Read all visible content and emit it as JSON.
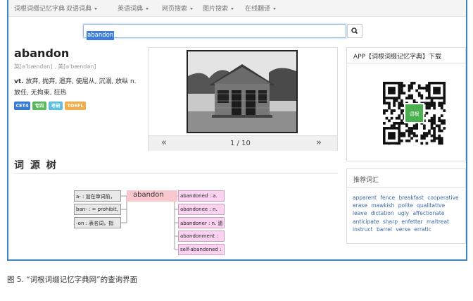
{
  "navbar": {
    "brand": "词根词缀记忆字典",
    "items": [
      {
        "label": "双语词典"
      },
      {
        "label": "英语词典"
      },
      {
        "label": "网页搜索"
      },
      {
        "label": "图片搜索"
      },
      {
        "label": "在线翻译"
      }
    ]
  },
  "search": {
    "value": "abandon"
  },
  "entry": {
    "word": "abandon",
    "phonetic": "英[ə'bændən] , 美[ə'bændən]",
    "pos": "vt.",
    "definition_line1": "放弃, 抛弃, 遗弃, 使屈从, 沉溺, 放纵 n.",
    "definition_line2": "放任, 无拘束, 狂热",
    "tags": [
      {
        "label": "CET4",
        "color": "#3a7bd5"
      },
      {
        "label": "专四",
        "color": "#5cb85c"
      },
      {
        "label": "考研",
        "color": "#5bc0de"
      },
      {
        "label": "TOEFL",
        "color": "#f0ad4e"
      }
    ]
  },
  "gallery": {
    "counter": "1 / 10",
    "prev": "«",
    "next": "»"
  },
  "app_box": {
    "title": "APP【词根词缀记忆字典】下载",
    "qr_center_text": "词根"
  },
  "etymology": {
    "title": "词 源 树",
    "root": "abandon",
    "left_nodes": [
      {
        "text": "a- : 加在单词前，"
      },
      {
        "text": "ban- : = prohibit,"
      },
      {
        "text": "-on : 表名词，指"
      }
    ],
    "right_nodes": [
      {
        "text": "abandoned : a."
      },
      {
        "text": "abandonee : n."
      },
      {
        "text": "abandoner : n. 遗"
      },
      {
        "text": "abandonment :"
      },
      {
        "text": "self-abandoned :"
      }
    ]
  },
  "recommend": {
    "title": "推荐词汇",
    "words": [
      "apparent",
      "fence",
      "breakfast",
      "cooperative",
      "erase",
      "mawkish",
      "polite",
      "qualitative",
      "leave",
      "dictation",
      "ugly",
      "affectionate",
      "anticipate",
      "sharp",
      "enfetter",
      "maltreat",
      "instruct",
      "barrel",
      "verse",
      "erratic"
    ]
  },
  "caption": "图 5. “词根词缀记忆字典网”的查询界面",
  "colors": {
    "border": "#3a84c4",
    "root_node": "#f9c8cf",
    "child_node": "#fbd3f0",
    "link": "#3a6aa8"
  }
}
